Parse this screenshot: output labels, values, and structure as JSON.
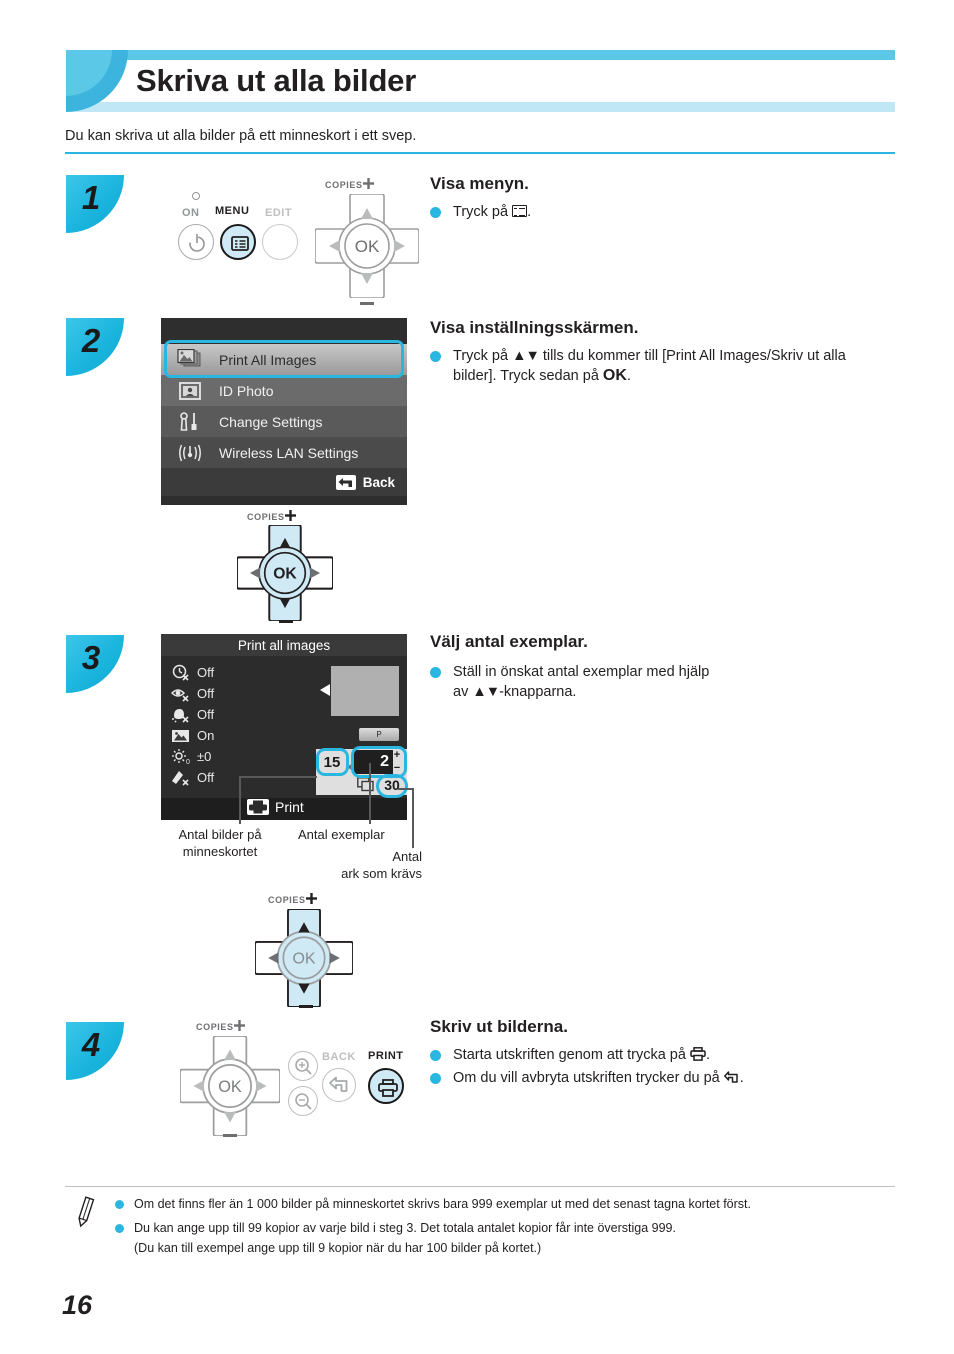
{
  "page": {
    "title": "Skriva ut alla bilder",
    "intro": "Du kan skriva ut alla bilder på ett minneskort i ett svep.",
    "number": "16"
  },
  "steps": [
    {
      "badge": "1",
      "heading": "Visa menyn.",
      "bullets": [
        "Tryck på  ."
      ],
      "bullet_prefix": "Tryck på",
      "bullet_suffix": "."
    },
    {
      "badge": "2",
      "heading": "Visa inställningsskärmen.",
      "bullet_line1_a": "Tryck på",
      "bullet_line1_b": "▲▼",
      "bullet_line1_c": "tills du kommer till [Print All Images/Skriv",
      "bullet_line2_a": "ut alla bilder]. Tryck sedan på",
      "bullet_line2_b": "OK",
      "bullet_line2_c": "."
    },
    {
      "badge": "3",
      "heading": "Välj antal exemplar.",
      "bullet_line1": "Ställ in önskat antal exemplar med hjälp",
      "bullet_line2_a": "av",
      "bullet_line2_b": "▲▼",
      "bullet_line2_c": "-knapparna."
    },
    {
      "badge": "4",
      "heading": "Skriv ut bilderna.",
      "bullet1_a": "Starta utskriften genom att trycka på",
      "bullet1_b": ".",
      "bullet2_a": "Om du vill avbryta utskriften trycker du på",
      "bullet2_b": "."
    }
  ],
  "device": {
    "on_label": "ON",
    "menu_label": "MENU",
    "edit_label": "EDIT",
    "copies_label": "COPIES",
    "ok_label": "OK",
    "back_label": "BACK",
    "print_label": "PRINT",
    "icons": {
      "power": "power-icon",
      "menu": "menu-icon",
      "ok": "ok-button",
      "zoom_in": "zoom-in-icon",
      "zoom_out": "zoom-out-icon",
      "back": "back-arrow-icon",
      "print": "printer-icon"
    }
  },
  "menu_screen": {
    "items": [
      {
        "label": "Print All Images",
        "icon": "images-stack-icon",
        "selected": true
      },
      {
        "label": "ID Photo",
        "icon": "id-photo-icon",
        "selected": false
      },
      {
        "label": "Change Settings",
        "icon": "tools-icon",
        "selected": false
      },
      {
        "label": "Wireless LAN Settings",
        "icon": "wifi-icon",
        "selected": false
      }
    ],
    "back_label": "Back"
  },
  "print_screen": {
    "title": "Print all images",
    "options": [
      {
        "icon": "date-off-icon",
        "value": "Off"
      },
      {
        "icon": "redeye-off-icon",
        "value": "Off"
      },
      {
        "icon": "skin-smooth-off-icon",
        "value": "Off"
      },
      {
        "icon": "borders-icon",
        "value": "On"
      },
      {
        "icon": "brightness-icon",
        "value": "±0"
      },
      {
        "icon": "effect-off-icon",
        "value": "Off"
      }
    ],
    "page_chip": "P",
    "images_on_card": "15",
    "copies": "2",
    "plus": "+",
    "minus": "−",
    "sheets_required": "30",
    "print_label": "Print"
  },
  "callouts": {
    "images_on_card": "Antal bilder på\nminneskortet",
    "images_on_card_l1": "Antal bilder på",
    "images_on_card_l2": "minneskortet",
    "copies": "Antal exemplar",
    "sheets_l1": "Antal",
    "sheets_l2": "ark som krävs"
  },
  "notes": [
    "Om det finns fler än 1 000 bilder på minneskortet skrivs bara 999 exemplar ut med det senast tagna kortet först.",
    "Du kan ange upp till 99 kopior av varje bild i steg 3. Det totala antalet kopior får inte överstiga 999.",
    "(Du kan till exempel ange upp till 9 kopior när du har 100 bilder på kortet.)"
  ],
  "colors": {
    "accent": "#29b6e0",
    "accent_light": "#bfe7f5",
    "badge": "#1ab4dd",
    "text": "#231f20"
  }
}
